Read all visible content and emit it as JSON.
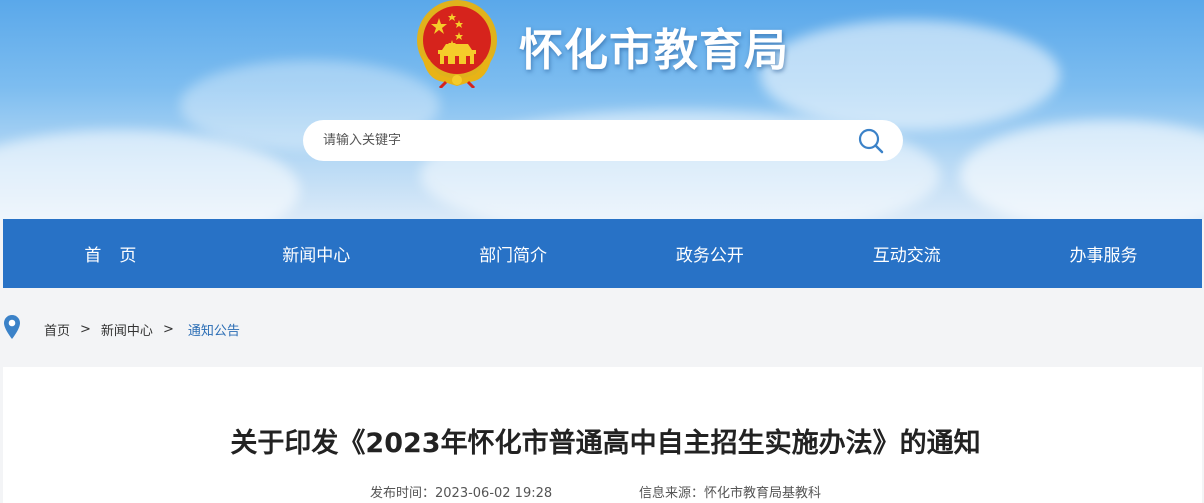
{
  "header": {
    "site_title": "怀化市教育局",
    "emblem_icon": "national-emblem-icon"
  },
  "search": {
    "placeholder": "请输入关键字",
    "value": "",
    "icon": "search-icon"
  },
  "nav": {
    "items": [
      {
        "label": "首页"
      },
      {
        "label": "新闻中心"
      },
      {
        "label": "部门简介"
      },
      {
        "label": "政务公开"
      },
      {
        "label": "互动交流"
      },
      {
        "label": "办事服务"
      }
    ]
  },
  "breadcrumb": {
    "icon": "location-pin-icon",
    "items": [
      "首页",
      "新闻中心",
      "通知公告"
    ],
    "separator": ">"
  },
  "article": {
    "title": "关于印发《2023年怀化市普通高中自主招生实施办法》的通知",
    "publish_time_label": "发布时间：2023-06-02 19:28",
    "source_label": "信息来源：怀化市教育局基教科"
  },
  "colors": {
    "nav_bg": "#2872c6",
    "accent_link": "#2a6db5",
    "emblem_red": "#d6231c",
    "emblem_gold": "#f2c200"
  }
}
